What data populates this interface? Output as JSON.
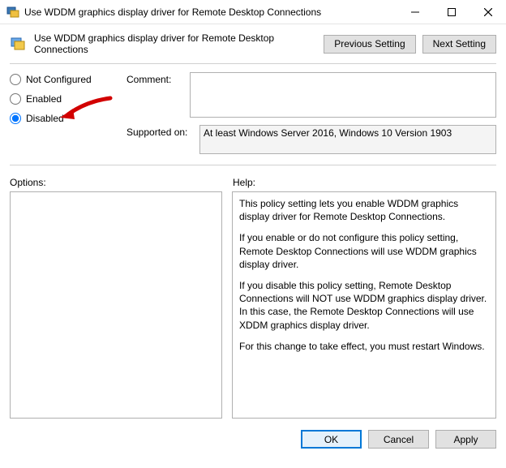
{
  "window": {
    "title": "Use WDDM graphics display driver for Remote Desktop Connections"
  },
  "header": {
    "policy_title": "Use WDDM graphics display driver for Remote Desktop Connections",
    "previous_setting": "Previous Setting",
    "next_setting": "Next Setting"
  },
  "state": {
    "options": {
      "not_configured": "Not Configured",
      "enabled": "Enabled",
      "disabled": "Disabled"
    },
    "selected": "disabled"
  },
  "form": {
    "comment_label": "Comment:",
    "comment_value": "",
    "supported_label": "Supported on:",
    "supported_value": "At least Windows Server 2016, Windows 10 Version 1903"
  },
  "sections": {
    "options_label": "Options:",
    "help_label": "Help:"
  },
  "help": {
    "p1": "This policy setting lets you enable WDDM graphics display driver for Remote Desktop Connections.",
    "p2": "If you enable or do not configure this policy setting, Remote Desktop Connections will use WDDM graphics display driver.",
    "p3": "If you disable this policy setting, Remote Desktop Connections will NOT use WDDM graphics display driver. In this case, the Remote Desktop Connections will use XDDM graphics display driver.",
    "p4": "For this change to take effect, you must restart Windows."
  },
  "footer": {
    "ok": "OK",
    "cancel": "Cancel",
    "apply": "Apply"
  },
  "annotation": {
    "arrow_color": "#d20000"
  }
}
